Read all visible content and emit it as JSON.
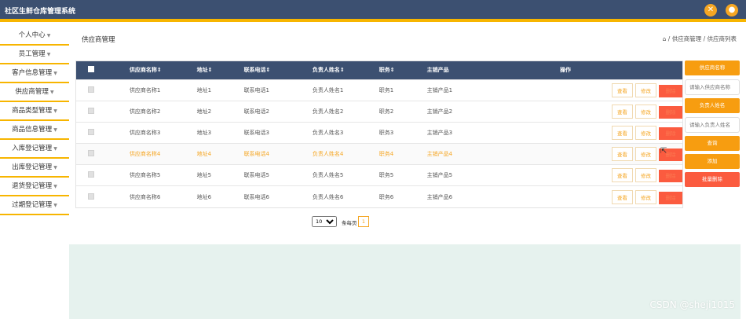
{
  "app": {
    "title": "社区生鲜仓库管理系统"
  },
  "topbar": {
    "icon1": "close-circle-icon",
    "icon2": "user-icon",
    "accent": "#f7b500",
    "bg": "#3c5071"
  },
  "sidebar": {
    "items": [
      {
        "label": "个人中心"
      },
      {
        "label": "员工管理"
      },
      {
        "label": "客户信息管理"
      },
      {
        "label": "供应商管理"
      },
      {
        "label": "商品类型管理"
      },
      {
        "label": "商品信息管理"
      },
      {
        "label": "入库登记管理"
      },
      {
        "label": "出库登记管理"
      },
      {
        "label": "退货登记管理"
      },
      {
        "label": "过期登记管理"
      }
    ]
  },
  "page": {
    "title": "供应商管理",
    "breadcrumb": "/ 供应商管理 / 供应商列表"
  },
  "table": {
    "headers": [
      "供应商名称⇕",
      "地址⇕",
      "联系电话⇕",
      "负责人姓名⇕",
      "职务⇕",
      "主销产品",
      "操作"
    ],
    "actions": {
      "view": "查看",
      "edit": "修改",
      "delete": "删除"
    },
    "rows": [
      {
        "name": "供应商名称1",
        "address": "地址1",
        "phone": "联系电话1",
        "manager": "负责人姓名1",
        "position": "职务1",
        "product": "主销产品1"
      },
      {
        "name": "供应商名称2",
        "address": "地址2",
        "phone": "联系电话2",
        "manager": "负责人姓名2",
        "position": "职务2",
        "product": "主销产品2"
      },
      {
        "name": "供应商名称3",
        "address": "地址3",
        "phone": "联系电话3",
        "manager": "负责人姓名3",
        "position": "职务3",
        "product": "主销产品3"
      },
      {
        "name": "供应商名称4",
        "address": "地址4",
        "phone": "联系电话4",
        "manager": "负责人姓名4",
        "position": "职务4",
        "product": "主销产品4"
      },
      {
        "name": "供应商名称5",
        "address": "地址5",
        "phone": "联系电话5",
        "manager": "负责人姓名5",
        "position": "职务5",
        "product": "主销产品5"
      },
      {
        "name": "供应商名称6",
        "address": "地址6",
        "phone": "联系电话6",
        "manager": "负责人姓名6",
        "position": "职务6",
        "product": "主销产品6"
      }
    ]
  },
  "pager": {
    "page_size": "10",
    "page_size_label": "条每页",
    "current_page": "1"
  },
  "search": {
    "supplier_label": "供应商名称",
    "supplier_placeholder": "请输入供应商名称",
    "manager_label": "负责人姓名",
    "manager_placeholder": "请输入负责人姓名",
    "query": "查询",
    "add": "添加",
    "batch_delete": "批量删除"
  },
  "watermark": "CSDN @sheji1015"
}
